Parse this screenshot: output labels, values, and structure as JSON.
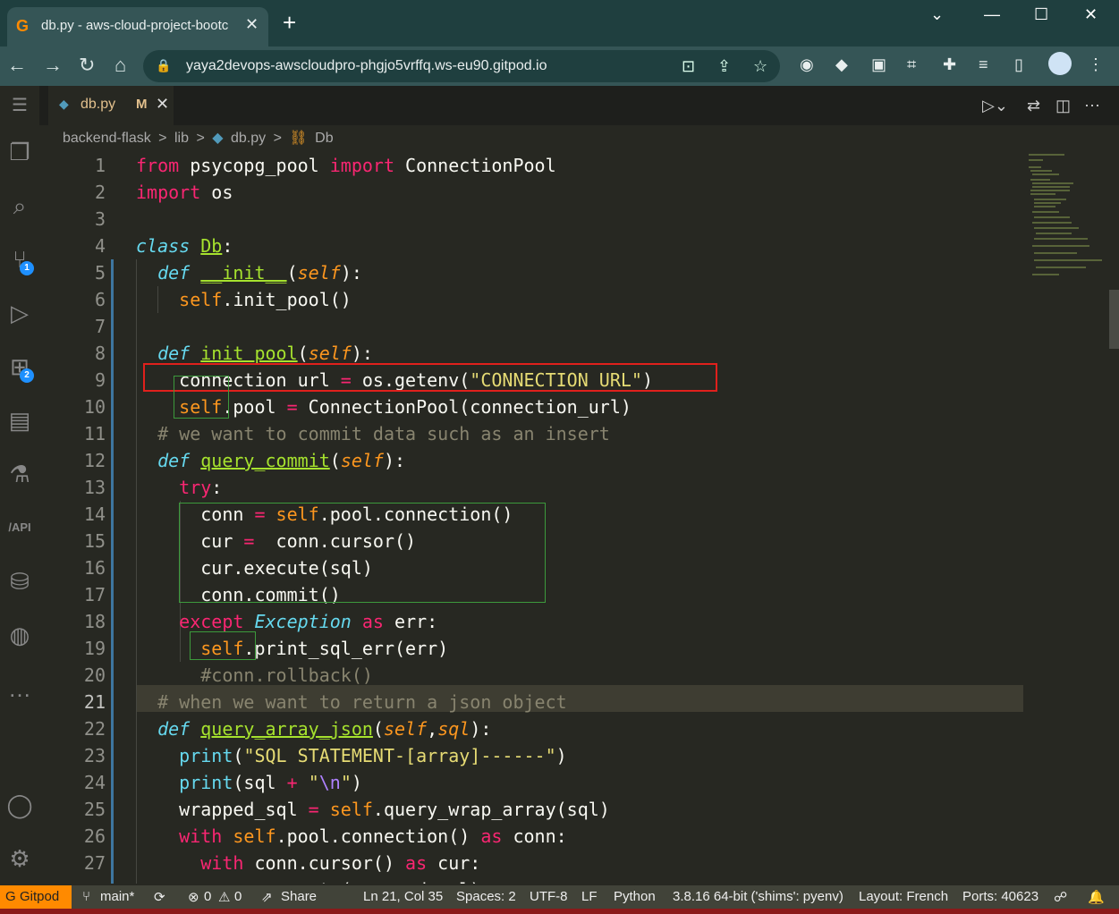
{
  "browser": {
    "tab_title": "db.py - aws-cloud-project-bootc",
    "tab_close": "✕",
    "new_tab": "+",
    "url": "yaya2devops-awscloudpro-phgjo5vrffq.ws-eu90.gitpod.io",
    "window_controls": {
      "dropdown": "⌄",
      "minimize": "—",
      "maximize": "☐",
      "close": "✕"
    }
  },
  "editor_tab": {
    "file": "db.py",
    "status": "M",
    "close": "✕"
  },
  "breadcrumb": {
    "folder1": "backend-flask",
    "folder2": "lib",
    "file": "db.py",
    "symbol": "Db",
    "sep": ">"
  },
  "activity_badges": {
    "source_control": "1",
    "extensions": "2"
  },
  "code": {
    "line_numbers": [
      "1",
      "2",
      "3",
      "4",
      "5",
      "6",
      "7",
      "8",
      "9",
      "10",
      "11",
      "12",
      "13",
      "14",
      "15",
      "16",
      "17",
      "18",
      "19",
      "20",
      "21",
      "22",
      "23",
      "24",
      "25",
      "26",
      "27"
    ]
  },
  "status_bar": {
    "gitpod": "Gitpod",
    "branch": "main*",
    "errors": "0",
    "warnings": "0",
    "share": "Share",
    "position": "Ln 21, Col 35",
    "spaces": "Spaces: 2",
    "encoding": "UTF-8",
    "eol": "LF",
    "language": "Python",
    "interpreter": "3.8.16 64-bit ('shims': pyenv)",
    "layout": "Layout: French",
    "ports": "Ports: 40623"
  },
  "colors": {
    "background": "#272822",
    "keyword": "#f92672",
    "function": "#a6e22e",
    "self": "#fd971f",
    "string": "#e6db74",
    "comment": "#88846f",
    "red_box": "#e0201c",
    "green_box": "#3c9a3c",
    "gitpod_orange": "#ff8a00"
  }
}
